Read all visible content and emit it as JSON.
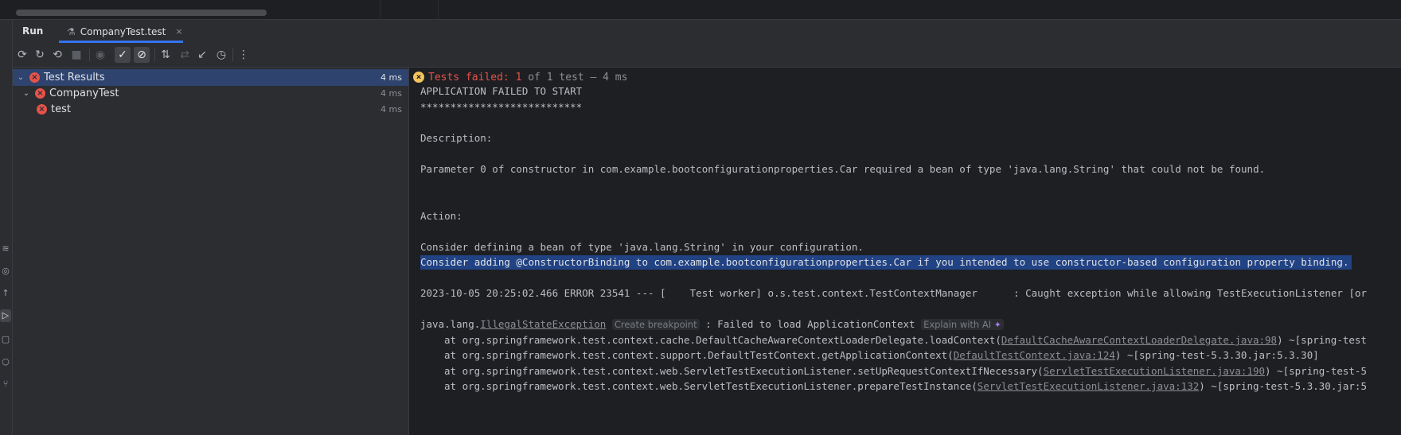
{
  "tool_window": {
    "title": "Run",
    "tab_label": "CompanyTest.test",
    "tab_close": "×"
  },
  "toolbar": {
    "buttons": [
      {
        "name": "rerun-button",
        "glyph": "⟳",
        "enabled": true
      },
      {
        "name": "rerun-failed-button",
        "glyph": "↻",
        "enabled": true
      },
      {
        "name": "toggle-auto-test-button",
        "glyph": "⟲",
        "enabled": true
      },
      {
        "name": "stop-button",
        "glyph": "■",
        "enabled": false
      },
      {
        "name": "show-ignored-button",
        "glyph": "◉",
        "enabled": false
      },
      {
        "name": "show-passed-button",
        "glyph": "✓",
        "toggled": true
      },
      {
        "name": "show-ignored-toggle-button",
        "glyph": "⊘",
        "toggled": true
      },
      {
        "name": "sort-button",
        "glyph": "⇅",
        "enabled": true
      },
      {
        "name": "import-results-button",
        "glyph": "⇄",
        "enabled": false
      },
      {
        "name": "collapse-button",
        "glyph": "↙",
        "enabled": true
      },
      {
        "name": "history-button",
        "glyph": "◷",
        "enabled": true
      },
      {
        "name": "more-button",
        "glyph": "⋮",
        "enabled": true
      }
    ]
  },
  "tree": {
    "rows": [
      {
        "label": "Test Results",
        "time": "4 ms",
        "status": "failed",
        "expanded": true,
        "level": 0
      },
      {
        "label": "CompanyTest",
        "time": "4 ms",
        "status": "failed",
        "expanded": true,
        "level": 1
      },
      {
        "label": "test",
        "time": "4 ms",
        "status": "failed",
        "level": 2
      }
    ]
  },
  "console": {
    "status_failed": "Tests failed: 1",
    "status_rest": " of 1 test – 4 ms",
    "lines": {
      "l1": "APPLICATION FAILED TO START",
      "l2": "***************************",
      "l3": "Description:",
      "l4": "Parameter 0 of constructor in com.example.bootconfigurationproperties.Car required a bean of type 'java.lang.String' that could not be found.",
      "l5": "Action:",
      "l6": "Consider defining a bean of type 'java.lang.String' in your configuration.",
      "l7": "Consider adding @ConstructorBinding to com.example.bootconfigurationproperties.Car if you intended to use constructor-based configuration property binding.",
      "l8": "2023-10-05 20:25:02.466 ERROR 23541 --- [    Test worker] o.s.test.context.TestContextManager      : Caught exception while allowing TestExecutionListener [or",
      "l9_prefix": "java.lang.",
      "l9_link": "IllegalStateException",
      "l9_hint": "Create breakpoint",
      "l9_mid": " : Failed to load ApplicationContext ",
      "l9_ai": "Explain with AI",
      "l10_prefix": "at org.springframework.test.context.cache.DefaultCacheAwareContextLoaderDelegate.loadContext(",
      "l10_link": "DefaultCacheAwareContextLoaderDelegate.java:98",
      "l10_suffix": ") ~[spring-test",
      "l11_prefix": "at org.springframework.test.context.support.DefaultTestContext.getApplicationContext(",
      "l11_link": "DefaultTestContext.java:124",
      "l11_suffix": ") ~[spring-test-5.3.30.jar:5.3.30]",
      "l12_prefix": "at org.springframework.test.context.web.ServletTestExecutionListener.setUpRequestContextIfNecessary(",
      "l12_link": "ServletTestExecutionListener.java:190",
      "l12_suffix": ") ~[spring-test-5",
      "l13_prefix": "at org.springframework.test.context.web.ServletTestExecutionListener.prepareTestInstance(",
      "l13_link": "ServletTestExecutionListener.java:132",
      "l13_suffix": ") ~[spring-test-5.3.30.jar:5"
    }
  },
  "icons": {
    "fail": "×",
    "warn": "×",
    "expand": "⌄",
    "sparkle": "✦"
  },
  "colors": {
    "fail_red": "#e5534b",
    "selection_blue": "#214283",
    "accent": "#3574f0"
  }
}
